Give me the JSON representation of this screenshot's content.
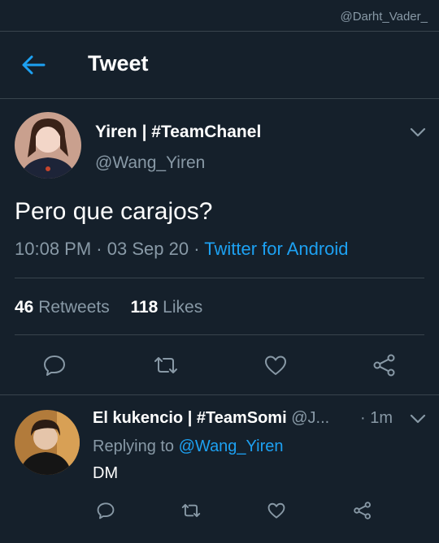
{
  "watermark": "@Darht_Vader_",
  "header": {
    "title": "Tweet",
    "back_icon": "arrow-left-icon"
  },
  "tweet": {
    "display_name": "Yiren | #TeamChanel",
    "handle": "@Wang_Yiren",
    "text": "Pero que carajos?",
    "time": "10:08 PM",
    "date": "03 Sep 20",
    "separator": "·",
    "source": "Twitter for Android",
    "retweets_count": "46",
    "retweets_label": "Retweets",
    "likes_count": "118",
    "likes_label": "Likes",
    "actions": [
      "reply-icon",
      "retweet-icon",
      "like-icon",
      "share-icon"
    ]
  },
  "reply": {
    "display_name": "El kukencio | #TeamSomi",
    "handle": "@J...",
    "time": "· 1m",
    "replying_label": "Replying to",
    "replying_to": "@Wang_Yiren",
    "text": "DM",
    "actions": [
      "reply-icon",
      "retweet-icon",
      "like-icon",
      "share-icon"
    ]
  },
  "colors": {
    "background": "#15202b",
    "accent": "#1da1f2",
    "muted": "#8899a6",
    "divider": "#38444d"
  }
}
